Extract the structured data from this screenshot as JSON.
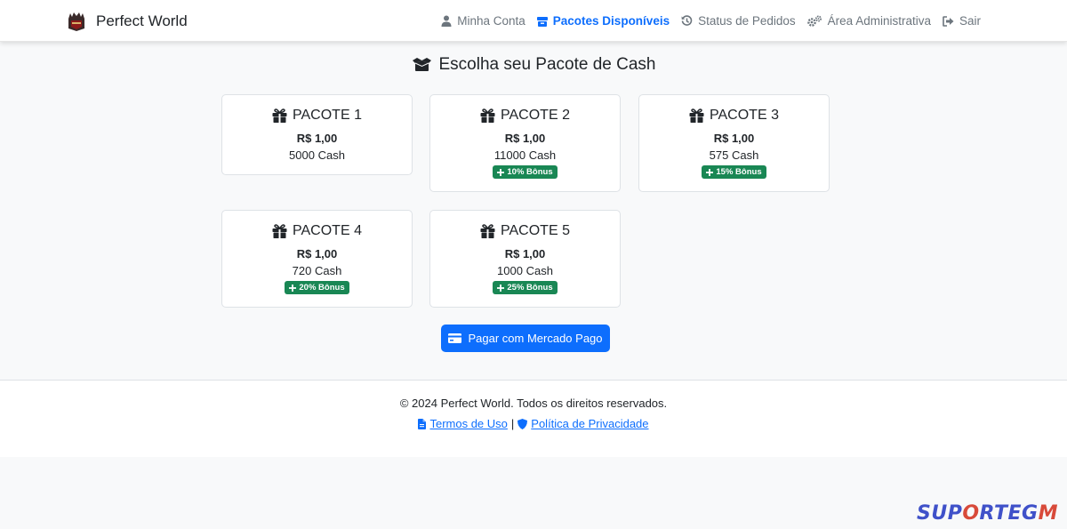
{
  "navbar": {
    "brand": "Perfect World",
    "links": [
      {
        "label": "Minha Conta",
        "icon": "user-icon",
        "active": false
      },
      {
        "label": "Pacotes Disponíveis",
        "icon": "box-icon",
        "active": true
      },
      {
        "label": "Status de Pedidos",
        "icon": "history-icon",
        "active": false
      },
      {
        "label": "Área Administrativa",
        "icon": "cogs-icon",
        "active": false
      },
      {
        "label": "Sair",
        "icon": "sign-out-icon",
        "active": false
      }
    ]
  },
  "page": {
    "title": "Escolha seu Pacote de Cash"
  },
  "packages": [
    {
      "name": "PACOTE 1",
      "price": "R$ 1,00",
      "cash": "5000 Cash",
      "bonus": ""
    },
    {
      "name": "PACOTE 2",
      "price": "R$ 1,00",
      "cash": "11000 Cash",
      "bonus": "10% Bônus"
    },
    {
      "name": "PACOTE 3",
      "price": "R$ 1,00",
      "cash": "575 Cash",
      "bonus": "15% Bônus"
    },
    {
      "name": "PACOTE 4",
      "price": "R$ 1,00",
      "cash": "720 Cash",
      "bonus": "20% Bônus"
    },
    {
      "name": "PACOTE 5",
      "price": "R$ 1,00",
      "cash": "1000 Cash",
      "bonus": "25% Bônus"
    }
  ],
  "pay_button": {
    "label": "Pagar com Mercado Pago"
  },
  "footer": {
    "copyright": "© 2024 Perfect World. Todos os direitos reservados.",
    "terms": "Termos de Uso",
    "separator": "|",
    "privacy": "Política de Privacidade"
  },
  "watermark": {
    "part1": "SUP",
    "part2": "O",
    "part3": "RTEG",
    "part4": "M"
  },
  "colors": {
    "primary": "#0d6efd",
    "success": "#198754",
    "background": "#f8f9fa"
  }
}
